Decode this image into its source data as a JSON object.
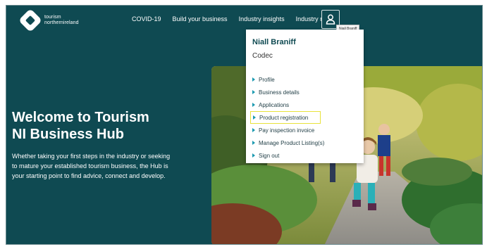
{
  "brand": {
    "line1": "tourism",
    "line2": "northernireland"
  },
  "nav": {
    "items": [
      "COVID-19",
      "Build your business",
      "Industry insights",
      "Industry news"
    ]
  },
  "user": {
    "tooltip": "Niall Braniff",
    "name": "Niall Braniff",
    "organisation": "Codec"
  },
  "menu": {
    "items": [
      "Profile",
      "Business details",
      "Applications",
      "Product registration",
      "Pay inspection invoice",
      "Manage Product Listing(s)",
      "Sign out"
    ],
    "highlighted_item": "Product registration"
  },
  "hero": {
    "title_line1": "Welcome to Tourism",
    "title_line2": "NI Business Hub",
    "description": "Whether taking your first steps in the industry or seeking to mature your established tourism business, the Hub is your starting point to find advice, connect and develop."
  },
  "colors": {
    "background": "#0f4a52",
    "menu_arrow": "#1c9ab0",
    "highlight": "#e8e23a",
    "menu_text": "#1e3c44"
  },
  "icons": [
    "logo-mark",
    "user-icon",
    "menu-arrow-icon"
  ]
}
